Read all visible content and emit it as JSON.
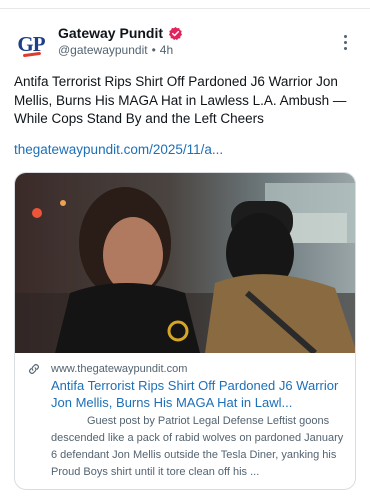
{
  "post": {
    "author": {
      "display_name": "Gateway Pundit",
      "handle": "@gatewaypundit",
      "separator": "•",
      "time": "4h",
      "avatar_text": "GP",
      "verified_color": "#e0245e"
    },
    "text": "Antifa Terrorist Rips Shirt Off Pardoned J6 Warrior Jon Mellis, Burns His MAGA Hat in Lawless L.A. Ambush — While Cops Stand By and the Left Cheers",
    "link": "thegatewaypundit.com/2025/11/a...",
    "more_icon": "more-vertical-icon"
  },
  "card": {
    "domain": "www.thegatewaypundit.com",
    "title": "Antifa Terrorist Rips Shirt Off Pardoned J6 Warrior Jon Mellis, Burns His MAGA Hat in Lawl...",
    "description": "Guest post by Patriot Legal Defense Leftist goons descended like a pack of rabid wolves on pardoned January 6 defendant Jon Mellis outside the Tesla Diner, yanking his Proud Boys shirt until it tore clean off his ...",
    "link_icon": "link-icon"
  },
  "colors": {
    "link": "#1d6fb8",
    "secondary_text": "#536471",
    "brand_blue": "#1d3f86",
    "brand_red": "#e03a2f"
  }
}
